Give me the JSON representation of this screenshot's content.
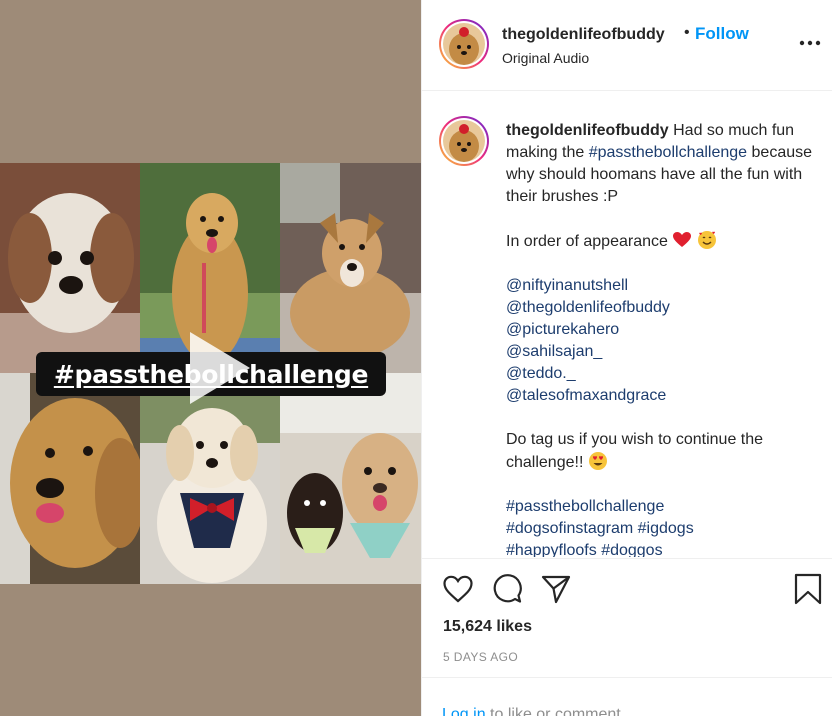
{
  "header": {
    "username": "thegoldenlifeofbuddy",
    "separator": "•",
    "follow_label": "Follow",
    "audio_label": "Original Audio"
  },
  "media": {
    "overlay_hashtag": "#passthebollchallenge"
  },
  "caption": {
    "username": "thegoldenlifeofbuddy",
    "text_intro": "Had so much fun making the",
    "hashtag_main": "#passthebollchallenge",
    "text_after": "because why should hoomans have all the fun with their brushes :P",
    "appearance_line": "In order of appearance",
    "mentions": [
      "@niftyinanutshell",
      "@thegoldenlifeofbuddy",
      "@picturekahero",
      "@sahilsajan_",
      "@teddo._",
      "@talesofmaxandgrace"
    ],
    "tag_invite": "Do tag us if you wish to continue the challenge!!",
    "hashtags_line1": [
      "#passthebollchallenge"
    ],
    "hashtags_line2": [
      "#dogsofinstagram",
      "#igdogs"
    ],
    "hashtags_line3": [
      "#happyfloofs",
      "#doggos"
    ]
  },
  "actions": {
    "likes": "15,624 likes",
    "date": "5 DAYS AGO",
    "login_link": "Log in",
    "login_rest": " to like or comment."
  },
  "icons": {
    "more": "more-options-icon",
    "like": "heart-icon",
    "comment": "comment-icon",
    "share": "paper-plane-icon",
    "save": "bookmark-icon",
    "play": "play-icon"
  },
  "colors": {
    "follow": "#0095f6",
    "hashtag": "#1d3d6e",
    "muted": "#8e8e8e",
    "media_bg": "#9e8b78"
  }
}
